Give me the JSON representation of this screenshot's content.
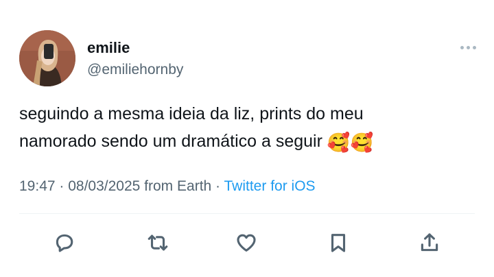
{
  "user": {
    "name": "emilie",
    "handle": "@emiliehornby"
  },
  "tweet": {
    "line1": "seguindo a mesma ideia da liz, prints do meu",
    "line2": "namorado sendo um dramático a seguir",
    "emoji": "🥰🥰"
  },
  "meta": {
    "time": "19:47",
    "separator1": " · ",
    "date": "08/03/2025",
    "location": " from Earth",
    "separator2": " · ",
    "source": "Twitter for iOS"
  },
  "icons": {
    "more": "more-horizontal-icon",
    "reply": "reply-icon",
    "retweet": "retweet-icon",
    "like": "heart-icon",
    "bookmark": "bookmark-icon",
    "share": "share-icon"
  },
  "colors": {
    "text": "#0f1419",
    "secondary": "#536471",
    "link": "#1d9bf0",
    "divider": "#eff3f4"
  }
}
